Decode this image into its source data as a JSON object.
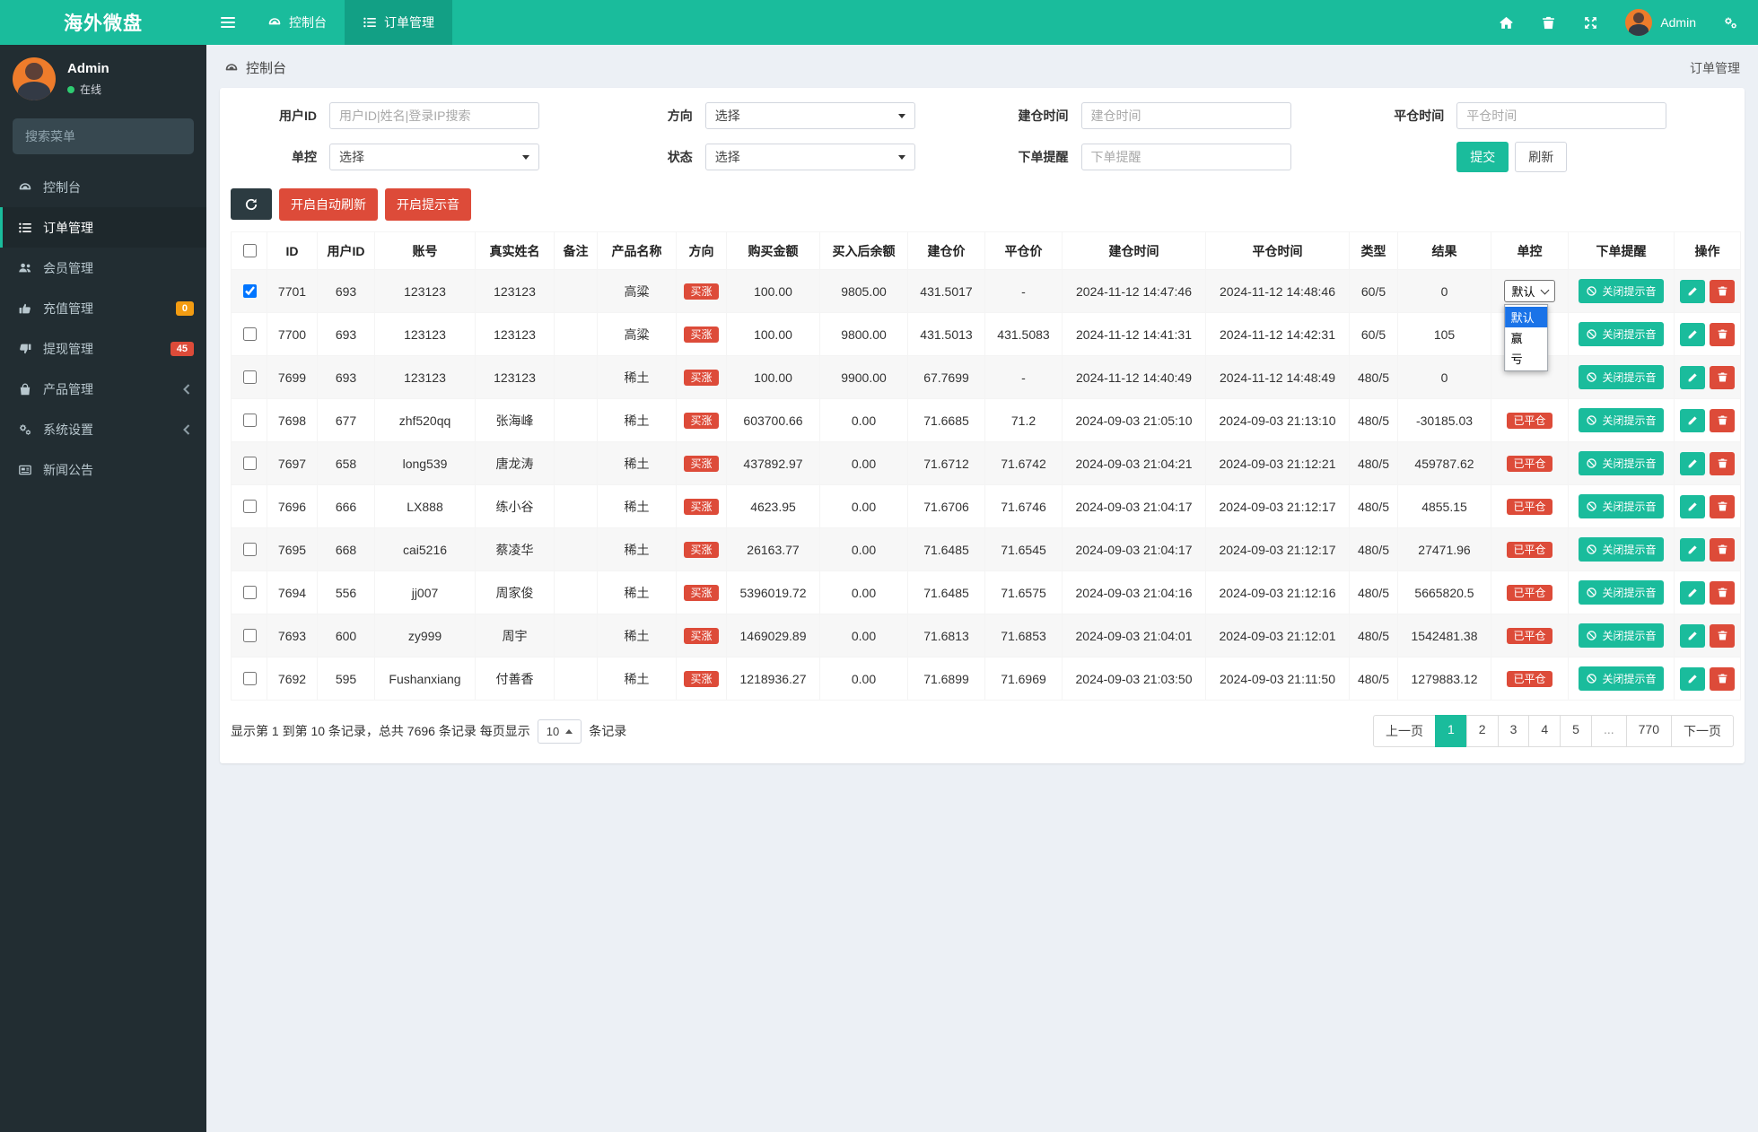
{
  "brand": {
    "title": "海外微盘"
  },
  "navbar": {
    "tabs": [
      {
        "icon": "gauge",
        "label": "控制台",
        "active": false
      },
      {
        "icon": "list",
        "label": "订单管理",
        "active": true
      }
    ],
    "user_name": "Admin"
  },
  "user_panel": {
    "name": "Admin",
    "status": "在线"
  },
  "sidebar": {
    "search_placeholder": "搜索菜单",
    "items": [
      {
        "icon": "gauge",
        "label": "控制台"
      },
      {
        "icon": "list",
        "label": "订单管理",
        "active": true
      },
      {
        "icon": "users",
        "label": "会员管理"
      },
      {
        "icon": "thumb-up",
        "label": "充值管理",
        "badge": "0",
        "badge_color": "#f39c12"
      },
      {
        "icon": "thumb-down",
        "label": "提现管理",
        "badge": "45",
        "badge_color": "#dd4b39"
      },
      {
        "icon": "bag",
        "label": "产品管理",
        "chevron": true
      },
      {
        "icon": "gears",
        "label": "系统设置",
        "chevron": true
      },
      {
        "icon": "newspaper",
        "label": "新闻公告"
      }
    ]
  },
  "breadcrumb": {
    "left": "控制台",
    "right": "订单管理"
  },
  "filters": {
    "user_id": {
      "label": "用户ID",
      "placeholder": "用户ID|姓名|登录IP搜索"
    },
    "direction": {
      "label": "方向",
      "value": "选择"
    },
    "open_time": {
      "label": "建仓时间",
      "placeholder": "建仓时间"
    },
    "close_time": {
      "label": "平仓时间",
      "placeholder": "平仓时间"
    },
    "control": {
      "label": "单控",
      "value": "选择"
    },
    "status": {
      "label": "状态",
      "value": "选择"
    },
    "order_notice": {
      "label": "下单提醒",
      "placeholder": "下单提醒"
    },
    "submit_label": "提交",
    "refresh_label": "刷新"
  },
  "toolbar": {
    "auto_refresh_label": "开启自动刷新",
    "sound_label": "开启提示音"
  },
  "table": {
    "columns": [
      "ID",
      "用户ID",
      "账号",
      "真实姓名",
      "备注",
      "产品名称",
      "方向",
      "购买金额",
      "买入后余额",
      "建仓价",
      "平仓价",
      "建仓时间",
      "平仓时间",
      "类型",
      "结果",
      "单控",
      "下单提醒",
      "操作"
    ],
    "direction_badge": "买涨",
    "closed_badge": "已平仓",
    "notice_button": "关闭提示音",
    "rows": [
      {
        "checked": true,
        "id": "7701",
        "uid": "693",
        "account": "123123",
        "name": "123123",
        "remark": "",
        "product": "高粱",
        "amount": "100.00",
        "balance": "9805.00",
        "open": "431.5017",
        "close": "-",
        "open_time": "2024-11-12 14:47:46",
        "close_time": "2024-11-12 14:48:46",
        "type": "60/5",
        "result": "0",
        "control": "select"
      },
      {
        "checked": false,
        "id": "7700",
        "uid": "693",
        "account": "123123",
        "name": "123123",
        "remark": "",
        "product": "高粱",
        "amount": "100.00",
        "balance": "9800.00",
        "open": "431.5013",
        "close": "431.5083",
        "open_time": "2024-11-12 14:41:31",
        "close_time": "2024-11-12 14:42:31",
        "type": "60/5",
        "result": "105",
        "control": "none"
      },
      {
        "checked": false,
        "id": "7699",
        "uid": "693",
        "account": "123123",
        "name": "123123",
        "remark": "",
        "product": "稀土",
        "amount": "100.00",
        "balance": "9900.00",
        "open": "67.7699",
        "close": "-",
        "open_time": "2024-11-12 14:40:49",
        "close_time": "2024-11-12 14:48:49",
        "type": "480/5",
        "result": "0",
        "control": "none"
      },
      {
        "checked": false,
        "id": "7698",
        "uid": "677",
        "account": "zhf520qq",
        "name": "张海峰",
        "remark": "",
        "product": "稀土",
        "amount": "603700.66",
        "balance": "0.00",
        "open": "71.6685",
        "close": "71.2",
        "open_time": "2024-09-03 21:05:10",
        "close_time": "2024-09-03 21:13:10",
        "type": "480/5",
        "result": "-30185.03",
        "control": "closed"
      },
      {
        "checked": false,
        "id": "7697",
        "uid": "658",
        "account": "long539",
        "name": "唐龙涛",
        "remark": "",
        "product": "稀土",
        "amount": "437892.97",
        "balance": "0.00",
        "open": "71.6712",
        "close": "71.6742",
        "open_time": "2024-09-03 21:04:21",
        "close_time": "2024-09-03 21:12:21",
        "type": "480/5",
        "result": "459787.62",
        "control": "closed"
      },
      {
        "checked": false,
        "id": "7696",
        "uid": "666",
        "account": "LX888",
        "name": "练小谷",
        "remark": "",
        "product": "稀土",
        "amount": "4623.95",
        "balance": "0.00",
        "open": "71.6706",
        "close": "71.6746",
        "open_time": "2024-09-03 21:04:17",
        "close_time": "2024-09-03 21:12:17",
        "type": "480/5",
        "result": "4855.15",
        "control": "closed"
      },
      {
        "checked": false,
        "id": "7695",
        "uid": "668",
        "account": "cai5216",
        "name": "蔡凌华",
        "remark": "",
        "product": "稀土",
        "amount": "26163.77",
        "balance": "0.00",
        "open": "71.6485",
        "close": "71.6545",
        "open_time": "2024-09-03 21:04:17",
        "close_time": "2024-09-03 21:12:17",
        "type": "480/5",
        "result": "27471.96",
        "control": "closed"
      },
      {
        "checked": false,
        "id": "7694",
        "uid": "556",
        "account": "jj007",
        "name": "周家俊",
        "remark": "",
        "product": "稀土",
        "amount": "5396019.72",
        "balance": "0.00",
        "open": "71.6485",
        "close": "71.6575",
        "open_time": "2024-09-03 21:04:16",
        "close_time": "2024-09-03 21:12:16",
        "type": "480/5",
        "result": "5665820.5",
        "control": "closed"
      },
      {
        "checked": false,
        "id": "7693",
        "uid": "600",
        "account": "zy999",
        "name": "周宇",
        "remark": "",
        "product": "稀土",
        "amount": "1469029.89",
        "balance": "0.00",
        "open": "71.6813",
        "close": "71.6853",
        "open_time": "2024-09-03 21:04:01",
        "close_time": "2024-09-03 21:12:01",
        "type": "480/5",
        "result": "1542481.38",
        "control": "closed"
      },
      {
        "checked": false,
        "id": "7692",
        "uid": "595",
        "account": "Fushanxiang",
        "name": "付善香",
        "remark": "",
        "product": "稀土",
        "amount": "1218936.27",
        "balance": "0.00",
        "open": "71.6899",
        "close": "71.6969",
        "open_time": "2024-09-03 21:03:50",
        "close_time": "2024-09-03 21:11:50",
        "type": "480/5",
        "result": "1279883.12",
        "control": "closed"
      }
    ]
  },
  "control_dropdown": {
    "value": "默认",
    "options": [
      "默认",
      "赢",
      "亏"
    ],
    "selected_index": 0
  },
  "footer": {
    "summary_prefix": "显示第 1 到第 10 条记录，总共 7696 条记录 每页显示",
    "per_page": "10",
    "summary_suffix": "条记录"
  },
  "pagination": {
    "prev": "上一页",
    "pages": [
      "1",
      "2",
      "3",
      "4",
      "5",
      "...",
      "770"
    ],
    "active": "1",
    "next": "下一页"
  },
  "colors": {
    "brand_teal": "#1abc9c",
    "navbar_active": "#12a085",
    "sidebar_dark": "#222d32",
    "danger_red": "#dd4b39",
    "warning_orange": "#f39c12",
    "online_green": "#2ecc71",
    "dropdown_highlight": "#1a73e8",
    "content_bg": "#ecf0f5"
  }
}
